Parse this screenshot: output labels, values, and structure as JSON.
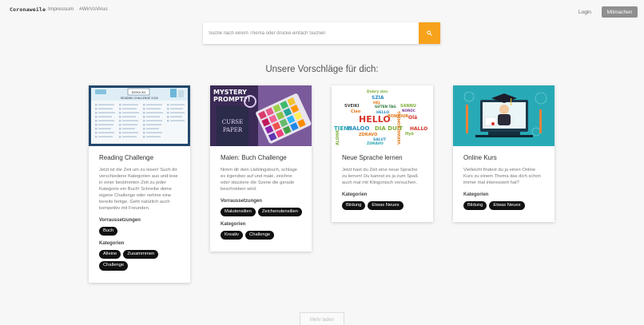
{
  "nav": {
    "brand": "Coronaweile",
    "links": [
      "Impressum",
      "#WirVsVirus"
    ],
    "login": "Login",
    "cta": "Mitmachen"
  },
  "search": {
    "placeholder": "Suche nach einem Thema oder drücke einfach Suchen",
    "button_icon": "search-icon"
  },
  "heading": "Unsere Vorschläge für dich:",
  "colors": {
    "accent": "#f7a21b",
    "tag_bg": "#111111",
    "page_bg": "#f7f7f7",
    "cta_bg": "#8f8f8f"
  },
  "cards": [
    {
      "title": "Reading Challenge",
      "image_text": {
        "title": "READING CHALLENGE 2020",
        "badge": "DYMOCKS"
      },
      "text": "Jetzt ist die Zeit um zu lesen! Such dir verschiedene Kategorien aus und lese in einer bestimmten Zeit zu jeder Kategorie ein Buch! Schreibe deine eigene Challenge oder nehme eine bereits fertige. Geht natürlich auch kompetitiv mit Freunden.",
      "requirements_label": "Vorraussetzungen",
      "requirements": [
        "Buch"
      ],
      "categories_label": "Kategorien",
      "categories": [
        "Alleine",
        "Zusammmen",
        "Challenge"
      ]
    },
    {
      "title": "Malen: Buch Challenge",
      "image_text": {
        "line1": "MYSTERY",
        "line2": "PROMPT?!",
        "book1": "CURSE",
        "book2": "PAPER"
      },
      "text": "Nimm dir dein Lieblingsbuch, schlage es irgendwo auf und male, zeichne oder skizziere die Szene die gerade beschrieben wird.",
      "requirements_label": "Vorraussetzungen",
      "requirements": [
        "Malutensilien",
        "Zeichenutensilien"
      ],
      "categories_label": "Kategorien",
      "categories": [
        "Kreativ",
        "Challenge"
      ]
    },
    {
      "title": "Neue Sprache lernen",
      "image_text": {
        "hello": "HELLO",
        "words": [
          "Dobrý den",
          "SZIA",
          "HEJ",
          "SVEIKI",
          "GUTEN TAG",
          "SANNU",
          "Ciao",
          "NOROC",
          "HELLO",
          "BONJOUR",
          "Olá",
          "TIENS",
          "HALOO",
          "DIA DUIT",
          "HALLO",
          "ZDRAVO",
          "Hyö",
          "ALOHA",
          "SALUT",
          "ZDRAVO",
          "VERWELKOMING"
        ]
      },
      "text": "Jetzt hast du Zeit eine neue Sprache zu lernen! Du kannst es ja zum Spaß auch mal mit Klingonisch versuchen.",
      "categories_label": "Kategorien",
      "categories": [
        "Bildung",
        "Etwas Neues"
      ]
    },
    {
      "title": "Online Kurs",
      "text": "Vielleicht findest du ja einen Online Kurs zu einem Thema das dich schon immer mal interessiert hat?",
      "categories_label": "Kategorien",
      "categories": [
        "Bildung",
        "Etwas Neues"
      ]
    }
  ],
  "more_button": "Mehr laden"
}
